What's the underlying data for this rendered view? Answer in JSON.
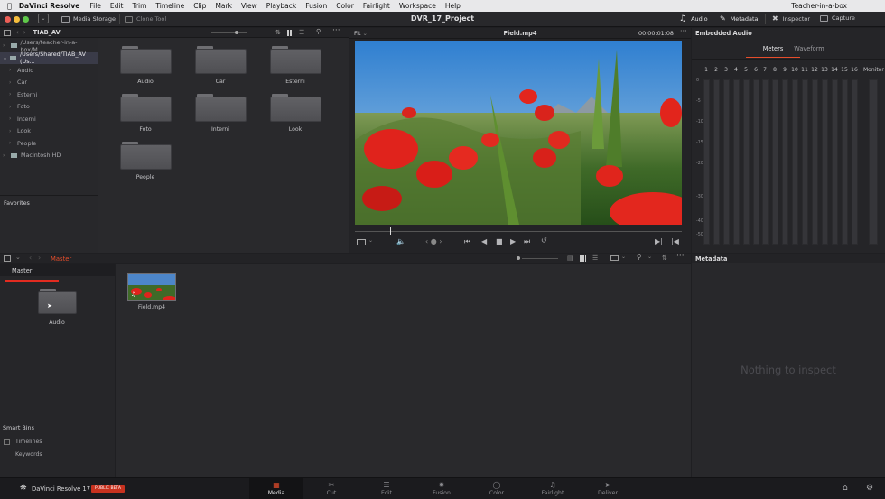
{
  "menubar": {
    "app": "DaVinci Resolve",
    "items": [
      "File",
      "Edit",
      "Trim",
      "Timeline",
      "Clip",
      "Mark",
      "View",
      "Playback",
      "Fusion",
      "Color",
      "Fairlight",
      "Workspace",
      "Help"
    ],
    "user": "Teacher-in-a-box"
  },
  "titlebar": {
    "media_storage": "Media Storage",
    "clone_tool": "Clone Tool",
    "project": "DVR_17_Project",
    "audio": "Audio",
    "metadata": "Metadata",
    "inspector": "Inspector",
    "capture": "Capture"
  },
  "media_storage": {
    "crumb": "TIAB_AV",
    "volumes": [
      {
        "label": "/Users/teacher-in-a-box/M...",
        "selected": false
      },
      {
        "label": "/Users/Shared/TIAB_AV (Us...",
        "selected": true
      }
    ],
    "subfolders": [
      "Audio",
      "Car",
      "Esterni",
      "Foto",
      "Interni",
      "Look",
      "People"
    ],
    "macintosh": "Macintosh HD",
    "favorites": "Favorites",
    "grid": [
      "Audio",
      "Car",
      "Esterni",
      "Foto",
      "Interni",
      "Look",
      "People"
    ]
  },
  "viewer": {
    "fit": "Fit",
    "clip_name": "Field.mp4",
    "timecode": "00:00:01:08"
  },
  "audio_panel": {
    "title": "Embedded Audio",
    "tab_meters": "Meters",
    "tab_waveform": "Waveform",
    "channels": [
      "1",
      "2",
      "3",
      "4",
      "5",
      "6",
      "7",
      "8",
      "9",
      "10",
      "11",
      "12",
      "13",
      "14",
      "15",
      "16"
    ],
    "monitor": "Monitor",
    "db_scale": [
      "0",
      "-5",
      "-10",
      "-15",
      "-20",
      "-30",
      "-40",
      "-50"
    ]
  },
  "media_pool": {
    "crumb": "Master",
    "master": "Master",
    "bin_folder": "Audio",
    "clip": "Field.mp4",
    "smart_bins": "Smart Bins",
    "timelines": "Timelines",
    "keywords": "Keywords"
  },
  "metadata_panel": {
    "title": "Metadata",
    "empty": "Nothing to inspect"
  },
  "bottom": {
    "brand": "DaVinci Resolve 17",
    "badge": "PUBLIC BETA",
    "pages": [
      "Media",
      "Cut",
      "Edit",
      "Fusion",
      "Color",
      "Fairlight",
      "Deliver"
    ],
    "active_page": "Media"
  },
  "colors": {
    "accent": "#e64d2b",
    "selection": "#3a3b48"
  }
}
